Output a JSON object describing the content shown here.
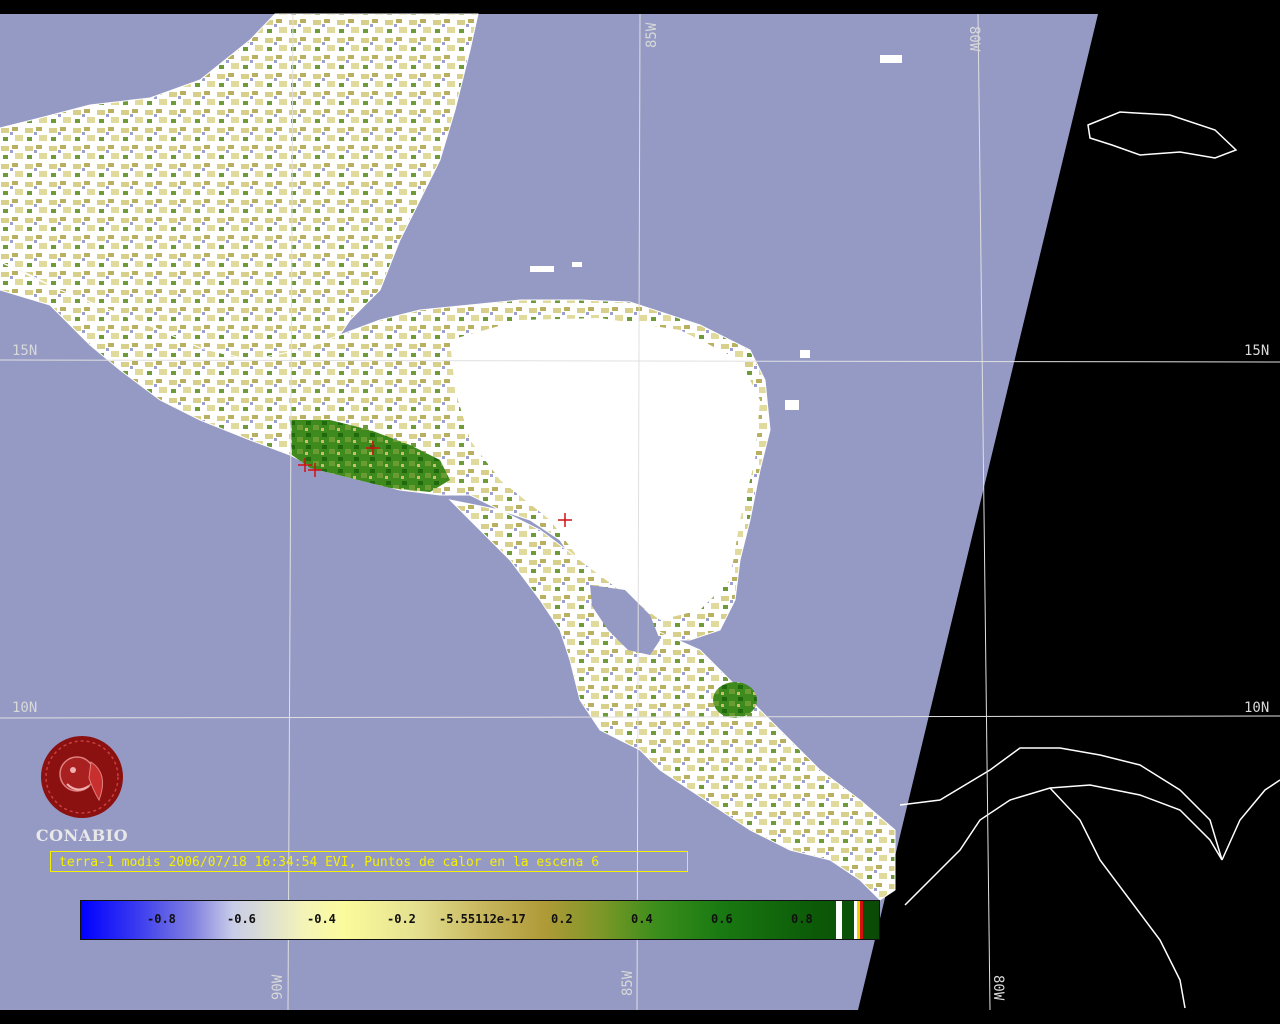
{
  "grid_labels": {
    "lat_15": "15N",
    "lat_10": "10N",
    "lon_85": "85W",
    "lon_90": "90W",
    "lon_80": "80W"
  },
  "logo": {
    "text": "CONABIO",
    "icon": "conabio-macaw-logo"
  },
  "caption": "terra-1 modis 2006/07/18 16:34:54 EVI, Puntos de calor en la escena 6",
  "colorbar": {
    "ticks": [
      "-0.8",
      "-0.6",
      "-0.4",
      "-0.2",
      "-5.55112e-17",
      "0.2",
      "0.4",
      "0.6",
      "0.8"
    ]
  },
  "colors": {
    "ocean": "#959ac4",
    "no_data": "#000000",
    "land_cloud": "#ffffff",
    "vegetation_low": "#d8d08a",
    "vegetation_high": "#2f7a14",
    "grid": "#e0e0e0",
    "caption": "#f5f000",
    "fire_marker": "#d01010",
    "logo": "#8b1010"
  }
}
